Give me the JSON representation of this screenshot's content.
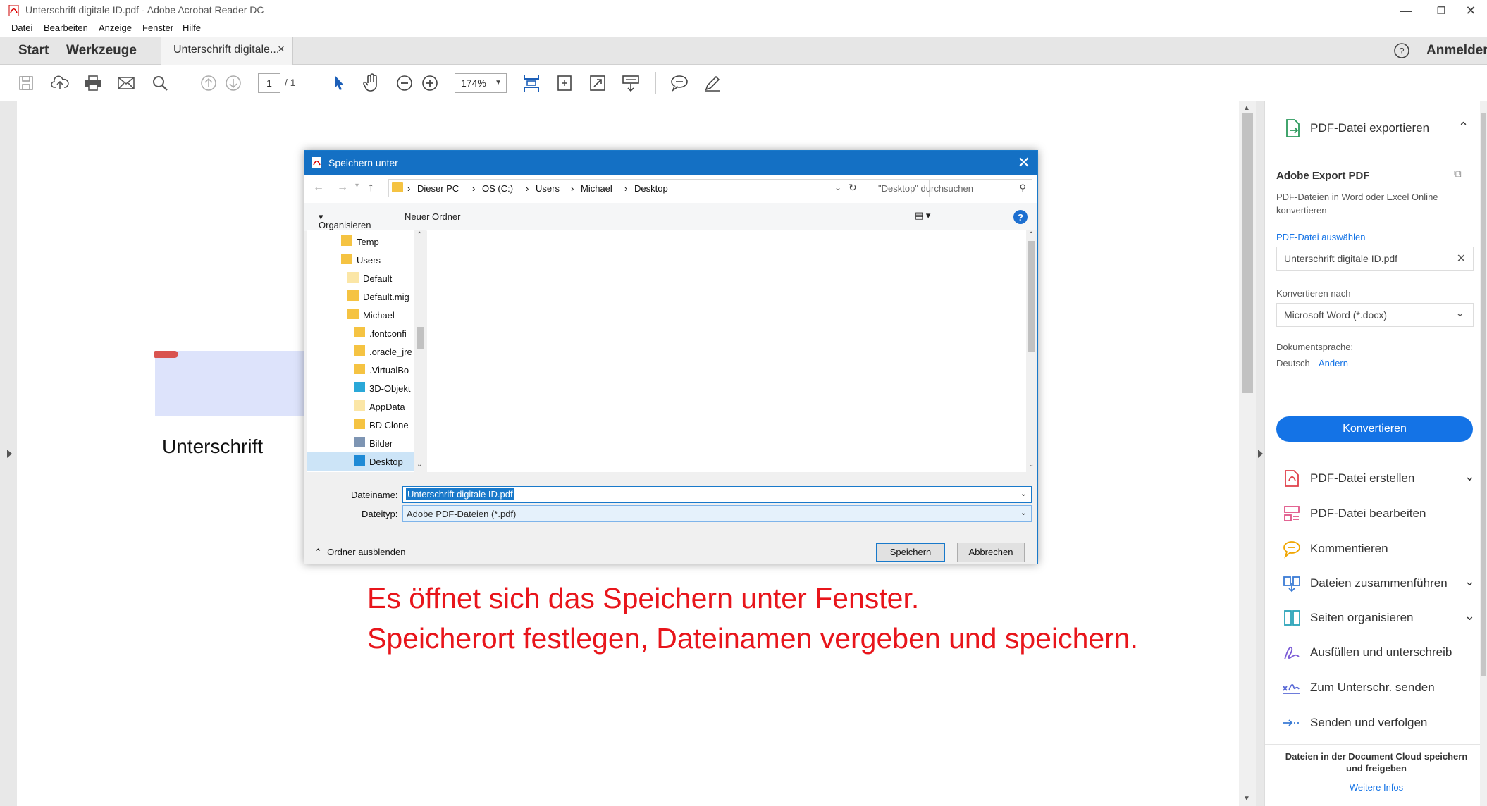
{
  "window": {
    "title": "Unterschrift digitale ID.pdf - Adobe Acrobat Reader DC"
  },
  "menu": [
    "Datei",
    "Bearbeiten",
    "Anzeige",
    "Fenster",
    "Hilfe"
  ],
  "tabs": {
    "start": "Start",
    "tools": "Werkzeuge",
    "document": "Unterschrift digitale...",
    "close": "×",
    "signin": "Anmelden"
  },
  "toolbar": {
    "page_current": "1",
    "page_total": "/ 1",
    "zoom": "174%"
  },
  "document": {
    "signature_label": "Unterschrift",
    "caption_line1": "Es öffnet sich das Speichern unter Fenster.",
    "caption_line2": "Speicherort festlegen, Dateinamen vergeben und speichern."
  },
  "dialog": {
    "title": "Speichern unter",
    "breadcrumb": [
      "Dieser PC",
      "OS (C:)",
      "Users",
      "Michael",
      "Desktop"
    ],
    "search_placeholder": "\"Desktop\" durchsuchen",
    "organize": "Organisieren",
    "new_folder": "Neuer Ordner",
    "nav_items": [
      {
        "label": "Temp",
        "icon": "folder-icon"
      },
      {
        "label": "Users",
        "icon": "folder-icon"
      },
      {
        "label": "Default",
        "icon": "folder-light-icon"
      },
      {
        "label": "Default.mig",
        "icon": "folder-icon"
      },
      {
        "label": "Michael",
        "icon": "folder-icon"
      },
      {
        "label": ".fontconfi",
        "icon": "folder-icon"
      },
      {
        "label": ".oracle_jre",
        "icon": "folder-icon"
      },
      {
        "label": ".VirtualBo",
        "icon": "folder-icon"
      },
      {
        "label": "3D-Objekt",
        "icon": "3d-objects-icon"
      },
      {
        "label": "AppData",
        "icon": "folder-light-icon"
      },
      {
        "label": "BD Clone",
        "icon": "folder-icon"
      },
      {
        "label": "Bilder",
        "icon": "pictures-icon"
      },
      {
        "label": "Desktop",
        "icon": "desktop-icon"
      }
    ],
    "filename_label": "Dateiname:",
    "filename_value": "Unterschrift digitale ID.pdf",
    "filetype_label": "Dateityp:",
    "filetype_value": "Adobe PDF-Dateien (*.pdf)",
    "hide_folders": "Ordner ausblenden",
    "save": "Speichern",
    "cancel": "Abbrechen"
  },
  "right_panel": {
    "export_title": "PDF-Datei exportieren",
    "export_heading": "Adobe Export PDF",
    "export_desc_line1": "PDF-Dateien in Word oder Excel Online",
    "export_desc_line2": "konvertieren",
    "select_file_link": "PDF-Datei auswählen",
    "selected_file": "Unterschrift digitale ID.pdf",
    "convert_to_label": "Konvertieren nach",
    "convert_to_value": "Microsoft Word (*.docx)",
    "doc_lang_label": "Dokumentsprache:",
    "doc_lang_value": "Deutsch",
    "change_link": "Ändern",
    "convert_button": "Konvertieren",
    "tools": [
      {
        "label": "PDF-Datei erstellen",
        "chevron": true
      },
      {
        "label": "PDF-Datei bearbeiten",
        "chevron": false
      },
      {
        "label": "Kommentieren",
        "chevron": false
      },
      {
        "label": "Dateien zusammenführen",
        "chevron": true
      },
      {
        "label": "Seiten organisieren",
        "chevron": true
      },
      {
        "label": "Ausfüllen und unterschreib",
        "chevron": false
      },
      {
        "label": "Zum Unterschr. senden",
        "chevron": false
      },
      {
        "label": "Senden und verfolgen",
        "chevron": false
      }
    ],
    "cloud_text_line1": "Dateien in der Document Cloud speichern",
    "cloud_text_line2": "und freigeben",
    "more_info": "Weitere Infos"
  },
  "colors": {
    "accent_blue": "#1473e6",
    "dialog_titlebar": "#1470c4",
    "caption_red": "#e8151b",
    "signature_field": "#dde3fb"
  }
}
